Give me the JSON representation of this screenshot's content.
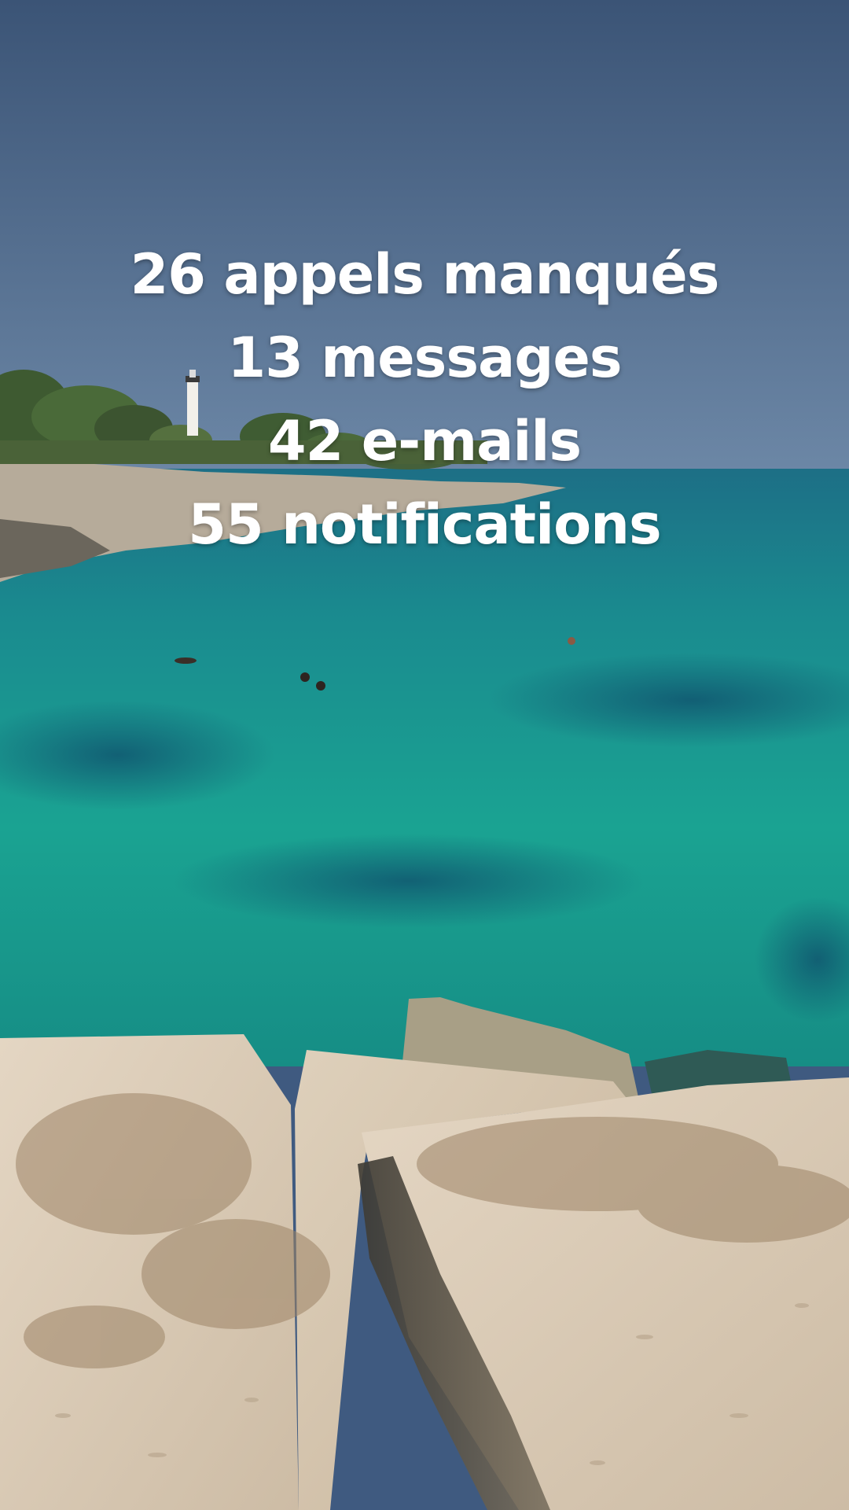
{
  "overlay": {
    "lines": [
      "26 appels manqués",
      "13 messages",
      "42 e-mails",
      "55 notifications"
    ]
  },
  "colors": {
    "sky_top": "#3b5478",
    "sky_horizon": "#6e8aa8",
    "sea_far": "#1f7d8c",
    "sea_near": "#1aa394",
    "rock_light": "#dccdb9",
    "rock_shadow": "#5a5448",
    "text": "#ffffff"
  }
}
